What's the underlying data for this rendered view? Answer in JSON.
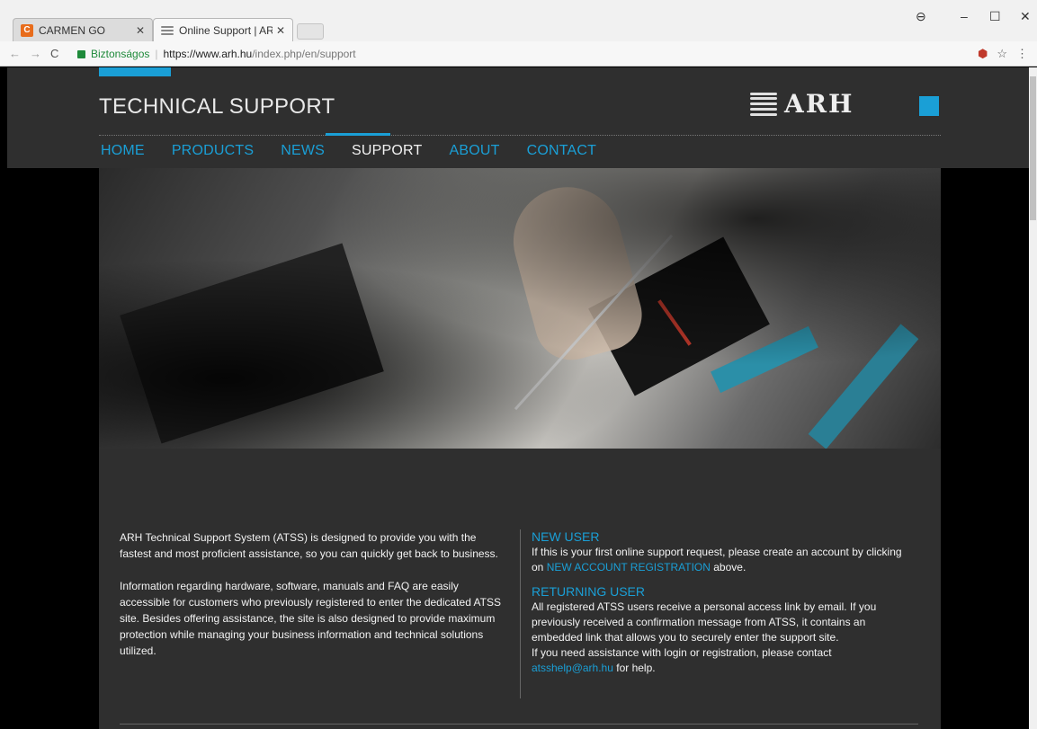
{
  "browser": {
    "tabs": [
      {
        "title": "CARMEN GO"
      },
      {
        "title": "Online Support | ARH Inc"
      }
    ],
    "address": {
      "secure_label": "Biztonságos",
      "url_host": "https://www.arh.hu",
      "url_path": "/index.php/en/support"
    },
    "icons": {
      "back": "back-arrow-icon",
      "forward": "forward-arrow-icon",
      "reload": "reload-icon",
      "lock": "lock-icon",
      "star": "star-icon",
      "menu": "kebab-menu-icon",
      "profile": "profile-icon"
    }
  },
  "site": {
    "header": {
      "title": "TECHNICAL SUPPORT",
      "logo_text": "ARH",
      "accent_color": "#1a9fd6"
    },
    "nav": [
      {
        "label": "HOME"
      },
      {
        "label": "PRODUCTS"
      },
      {
        "label": "NEWS"
      },
      {
        "label": "SUPPORT"
      },
      {
        "label": "ABOUT"
      },
      {
        "label": "CONTACT"
      }
    ],
    "active_nav": "SUPPORT",
    "content": {
      "left": {
        "p1": "ARH Technical Support System (ATSS) is designed to provide you with the fastest and most proficient assistance, so you can quickly get back to business.",
        "p2": "Information regarding hardware, software, manuals and FAQ are easily accessible for customers who previously registered to enter the dedicated ATSS site. Besides offering assistance, the site is also designed to provide maximum protection while managing your business information and technical solutions utilized."
      },
      "right": {
        "new_user_title": "NEW USER",
        "new_user_text_before": "If this is your first online support request, please create an account by clicking on ",
        "new_user_link": "NEW ACCOUNT REGISTRATION",
        "new_user_text_after": " above.",
        "returning_title": "RETURNING USER",
        "returning_text": "All registered ATSS users receive a personal access link by email. If you previously received a confirmation message from ATSS, it contains an embedded link that allows you to securely enter the support site.",
        "help_text_before": "If you need assistance with login or registration, please contact ",
        "help_email": "atsshelp@arh.hu",
        "help_text_after": " for help."
      }
    }
  }
}
